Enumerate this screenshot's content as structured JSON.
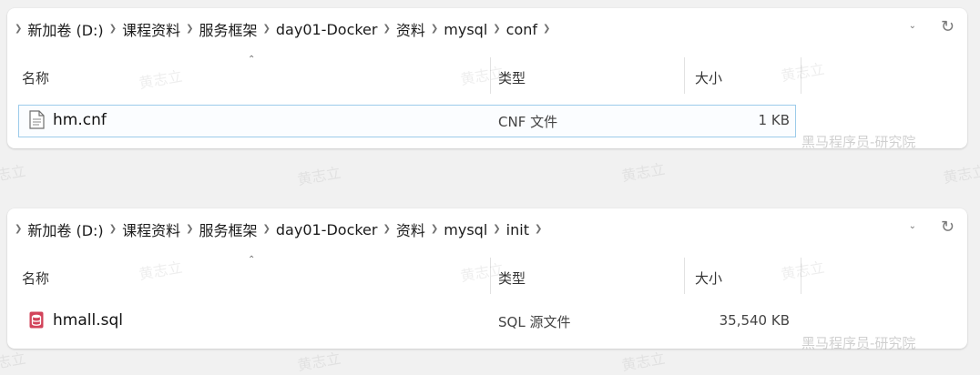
{
  "window1": {
    "breadcrumb": [
      "新加卷 (D:)",
      "课程资料",
      "服务框架",
      "day01-Docker",
      "资料",
      "mysql",
      "conf"
    ],
    "columns": {
      "name": "名称",
      "type": "类型",
      "size": "大小"
    },
    "file": {
      "name": "hm.cnf",
      "type": "CNF 文件",
      "size": "1 KB",
      "icon": "text-file-icon"
    }
  },
  "window2": {
    "breadcrumb": [
      "新加卷 (D:)",
      "课程资料",
      "服务框架",
      "day01-Docker",
      "资料",
      "mysql",
      "init"
    ],
    "columns": {
      "name": "名称",
      "type": "类型",
      "size": "大小"
    },
    "file": {
      "name": "hmall.sql",
      "type": "SQL 源文件",
      "size": "35,540 KB",
      "icon": "sql-file-icon"
    }
  },
  "icons": {
    "separator": "chevron-right-icon",
    "dropdown": "chevron-down-icon",
    "refresh": "refresh-icon",
    "sort": "sort-up-icon"
  },
  "colors": {
    "selection_border": "#9ccbea",
    "sql_icon": "#d2435a"
  },
  "watermark": {
    "faint": "黄志立",
    "brand": "黑马程序员-研究院"
  }
}
